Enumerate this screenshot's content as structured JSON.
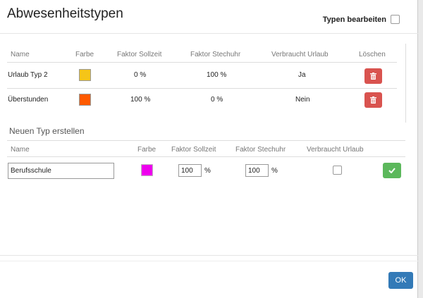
{
  "dialog": {
    "title": "Abwesenheitstypen",
    "edit_types_label": "Typen bearbeiten"
  },
  "types_table": {
    "headers": [
      "Name",
      "Farbe",
      "Faktor Sollzeit",
      "Faktor Stechuhr",
      "Verbraucht Urlaub",
      "Löschen"
    ],
    "rows": [
      {
        "name": "Urlaub Typ 2",
        "color": "#f5c518",
        "faktor_sollzeit": "0 %",
        "faktor_stechuhr": "100 %",
        "verbraucht_urlaub": "Ja",
        "delete_icon": "trash-icon"
      },
      {
        "name": "Überstunden",
        "color": "#ff5a00",
        "faktor_sollzeit": "100 %",
        "faktor_stechuhr": "0 %",
        "verbraucht_urlaub": "Nein",
        "delete_icon": "trash-icon"
      }
    ]
  },
  "new_type": {
    "section_title": "Neuen Typ erstellen",
    "headers": [
      "Name",
      "Farbe",
      "Faktor Sollzeit",
      "Faktor Stechuhr",
      "Verbraucht Urlaub"
    ],
    "name_value": "Berufsschule",
    "color": "#ee00ee",
    "faktor_sollzeit_value": "100",
    "faktor_stechuhr_value": "100",
    "percent_sign": "%",
    "verbraucht_urlaub_checked": false,
    "confirm_icon": "check-icon"
  },
  "footer": {
    "ok_label": "OK"
  },
  "colors": {
    "danger": "#d9534f",
    "success": "#5cb85c",
    "primary": "#337ab7"
  }
}
